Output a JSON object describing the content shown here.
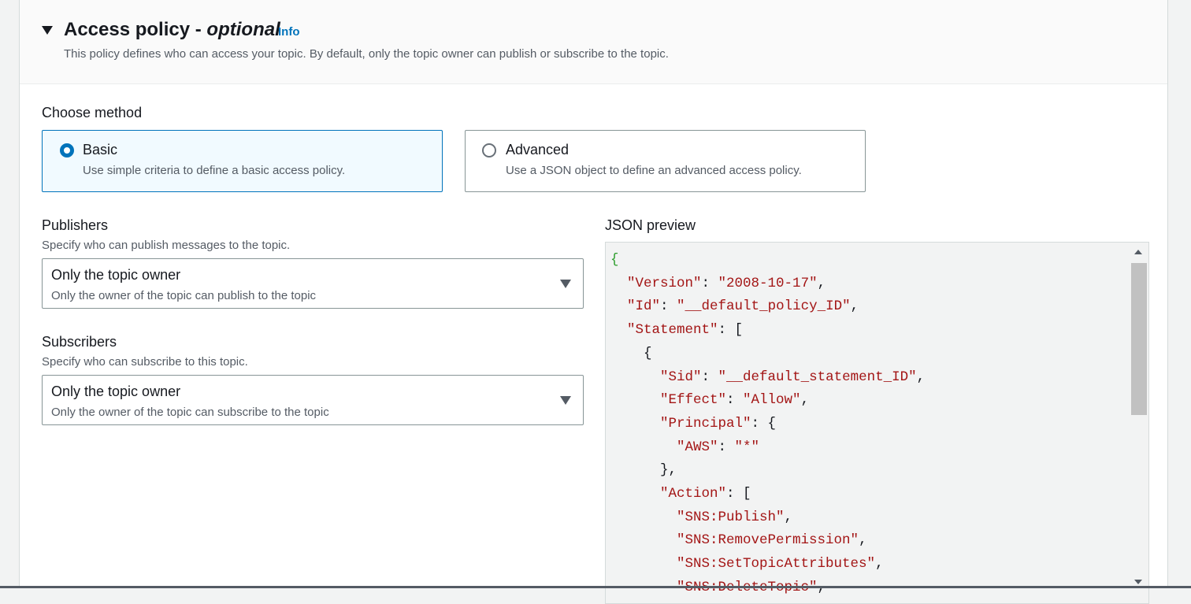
{
  "section": {
    "title": "Access policy",
    "separator": " - ",
    "optional": "optional",
    "info_link": "Info",
    "description": "This policy defines who can access your topic. By default, only the topic owner can publish or subscribe to the topic."
  },
  "method": {
    "label": "Choose method",
    "options": [
      {
        "title": "Basic",
        "description": "Use simple criteria to define a basic access policy.",
        "selected": true
      },
      {
        "title": "Advanced",
        "description": "Use a JSON object to define an advanced access policy.",
        "selected": false
      }
    ]
  },
  "publishers": {
    "label": "Publishers",
    "hint": "Specify who can publish messages to the topic.",
    "value": "Only the topic owner",
    "value_desc": "Only the owner of the topic can publish to the topic"
  },
  "subscribers": {
    "label": "Subscribers",
    "hint": "Specify who can subscribe to this topic.",
    "value": "Only the topic owner",
    "value_desc": "Only the owner of the topic can subscribe to the topic"
  },
  "json_preview": {
    "label": "JSON preview",
    "lines": [
      {
        "indent": 0,
        "open": "{"
      },
      {
        "indent": 1,
        "key": "Version",
        "value": "2008-10-17",
        "tail": ","
      },
      {
        "indent": 1,
        "key": "Id",
        "value": "__default_policy_ID",
        "tail": ","
      },
      {
        "indent": 1,
        "key": "Statement",
        "tail": ": ["
      },
      {
        "indent": 2,
        "open": "{"
      },
      {
        "indent": 3,
        "key": "Sid",
        "value": "__default_statement_ID",
        "tail": ","
      },
      {
        "indent": 3,
        "key": "Effect",
        "value": "Allow",
        "tail": ","
      },
      {
        "indent": 3,
        "key": "Principal",
        "tail": ": {"
      },
      {
        "indent": 4,
        "key": "AWS",
        "value": "*",
        "tail": ""
      },
      {
        "indent": 3,
        "open": "},"
      },
      {
        "indent": 3,
        "key": "Action",
        "tail": ": ["
      },
      {
        "indent": 4,
        "string": "SNS:Publish",
        "tail": ","
      },
      {
        "indent": 4,
        "string": "SNS:RemovePermission",
        "tail": ","
      },
      {
        "indent": 4,
        "string": "SNS:SetTopicAttributes",
        "tail": ","
      },
      {
        "indent": 4,
        "string": "SNS:DeleteTopic",
        "tail": ","
      }
    ]
  }
}
